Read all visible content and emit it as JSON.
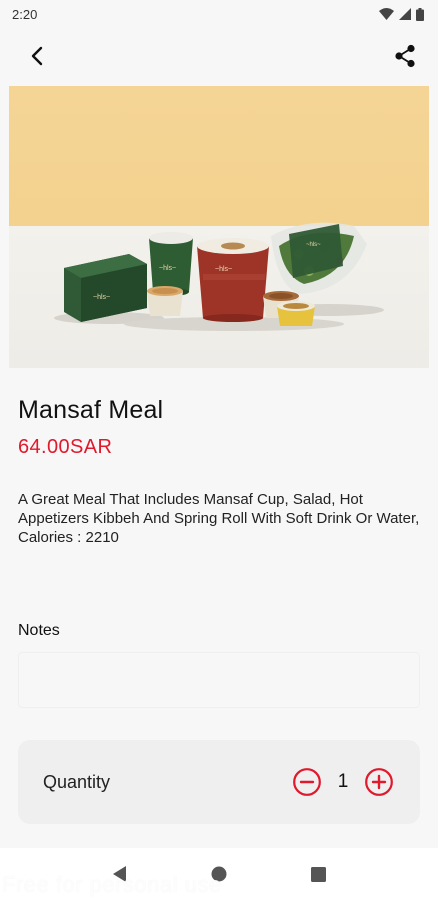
{
  "status_bar": {
    "time": "2:20"
  },
  "app_bar": {
    "back_icon": "back-arrow-icon",
    "share_icon": "share-icon"
  },
  "product": {
    "image": "meal-photo",
    "name": "Mansaf Meal",
    "price": "64.00SAR",
    "description": "A Great Meal That Includes Mansaf Cup, Salad, Hot Appetizers Kibbeh And Spring Roll With Soft Drink Or Water, Calories : 2210"
  },
  "notes": {
    "label": "Notes",
    "value": "",
    "placeholder": ""
  },
  "quantity": {
    "label": "Quantity",
    "value": "1"
  },
  "colors": {
    "accent": "#e0192d",
    "card": "#efefef",
    "background": "#f7f7f7"
  },
  "watermark": "Free for personal use"
}
